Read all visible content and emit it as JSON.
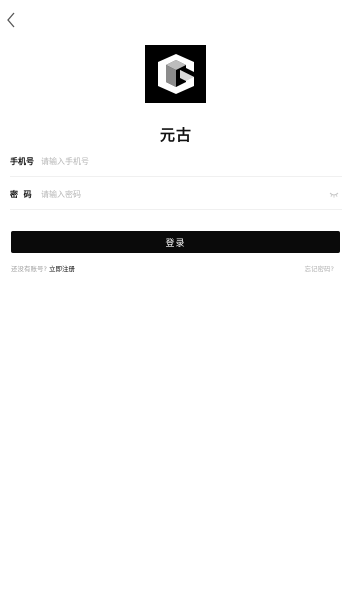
{
  "header": {
    "back_icon": "chevron-left-icon"
  },
  "logo": {
    "icon": "app-logo-icon",
    "background": "#000000"
  },
  "app_name": "元古",
  "form": {
    "phone": {
      "label": "手机号",
      "placeholder": "请输入手机号",
      "value": ""
    },
    "password": {
      "label": "密  码",
      "placeholder": "请输入密码",
      "value": "",
      "toggle_icon": "eye-closed-icon"
    }
  },
  "login_button": {
    "label": "登录",
    "background": "#0a0a0a"
  },
  "footer": {
    "no_account_text": "还没有账号?",
    "register_label": "立即注册",
    "forgot_label": "忘记密码?"
  }
}
